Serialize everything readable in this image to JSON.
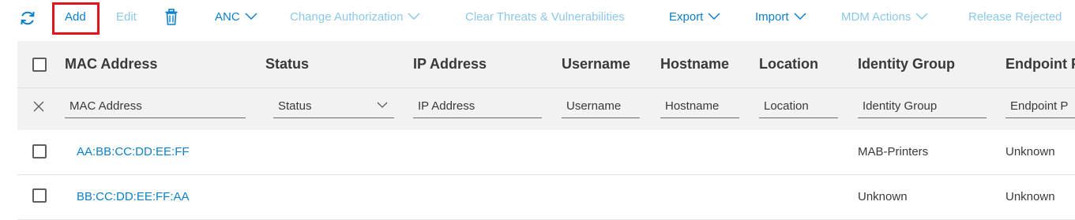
{
  "toolbar": {
    "add": "Add",
    "edit": "Edit",
    "anc": "ANC",
    "change_authorization": "Change Authorization",
    "clear_threats": "Clear Threats & Vulnerabilities",
    "export": "Export",
    "import": "Import",
    "mdm_actions": "MDM Actions",
    "release_rejected": "Release Rejected"
  },
  "columns": [
    "MAC Address",
    "Status",
    "IP Address",
    "Username",
    "Hostname",
    "Location",
    "Identity Group",
    "Endpoint P"
  ],
  "filters": {
    "mac": "MAC Address",
    "status": "Status",
    "ip": "IP Address",
    "username": "Username",
    "hostname": "Hostname",
    "location": "Location",
    "identity_group": "Identity Group",
    "endpoint": "Endpoint P"
  },
  "rows": [
    {
      "mac": "AA:BB:CC:DD:EE:FF",
      "identity_group": "MAB-Printers",
      "endpoint": "Unknown"
    },
    {
      "mac": "BB:CC:DD:EE:FF:AA",
      "identity_group": "Unknown",
      "endpoint": "Unknown"
    }
  ],
  "colors": {
    "link": "#0b7fc8",
    "disabled": "#8cc8ea",
    "highlight": "#e0161c",
    "header_bg": "#f2f2f2"
  }
}
